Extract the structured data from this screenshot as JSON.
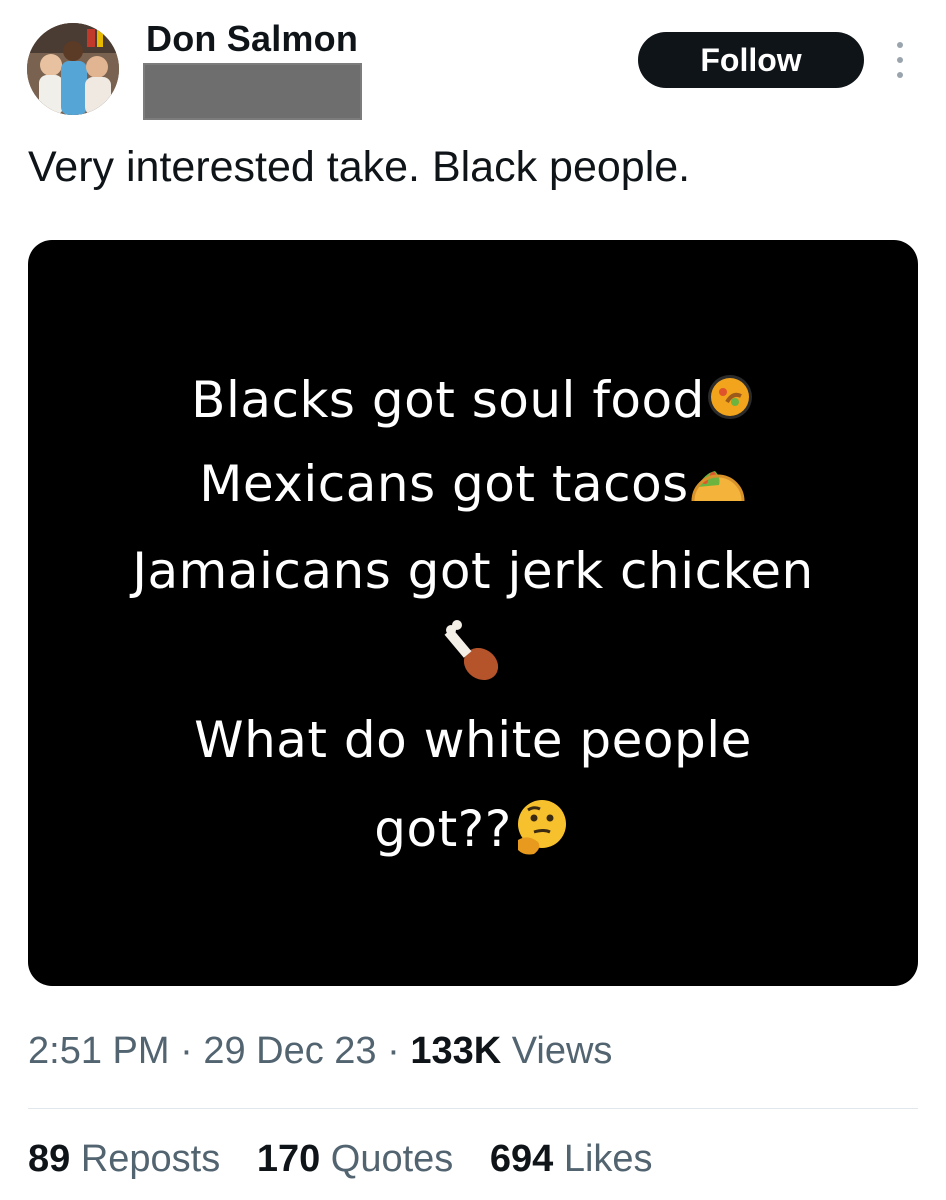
{
  "author": {
    "display_name": "Don Salmon",
    "follow_label": "Follow"
  },
  "tweet": {
    "text": "Very interested take. Black people."
  },
  "media": {
    "line1": "Blacks got soul food",
    "line2": "Mexicans got tacos",
    "line3": "Jamaicans got jerk chicken",
    "line4": "What do white people",
    "line5": "got??",
    "emojis": [
      "paella-emoji",
      "taco-emoji",
      "poultry-leg-emoji",
      "thinking-face-emoji"
    ]
  },
  "meta": {
    "time": "2:51 PM",
    "sep1": " · ",
    "date": "29 Dec 23",
    "sep2": " · ",
    "views_count": "133K",
    "views_label": " Views"
  },
  "stats": {
    "reposts_count": "89",
    "reposts_label": " Reposts",
    "quotes_count": "170",
    "quotes_label": " Quotes",
    "likes_count": "694",
    "likes_label": " Likes"
  }
}
